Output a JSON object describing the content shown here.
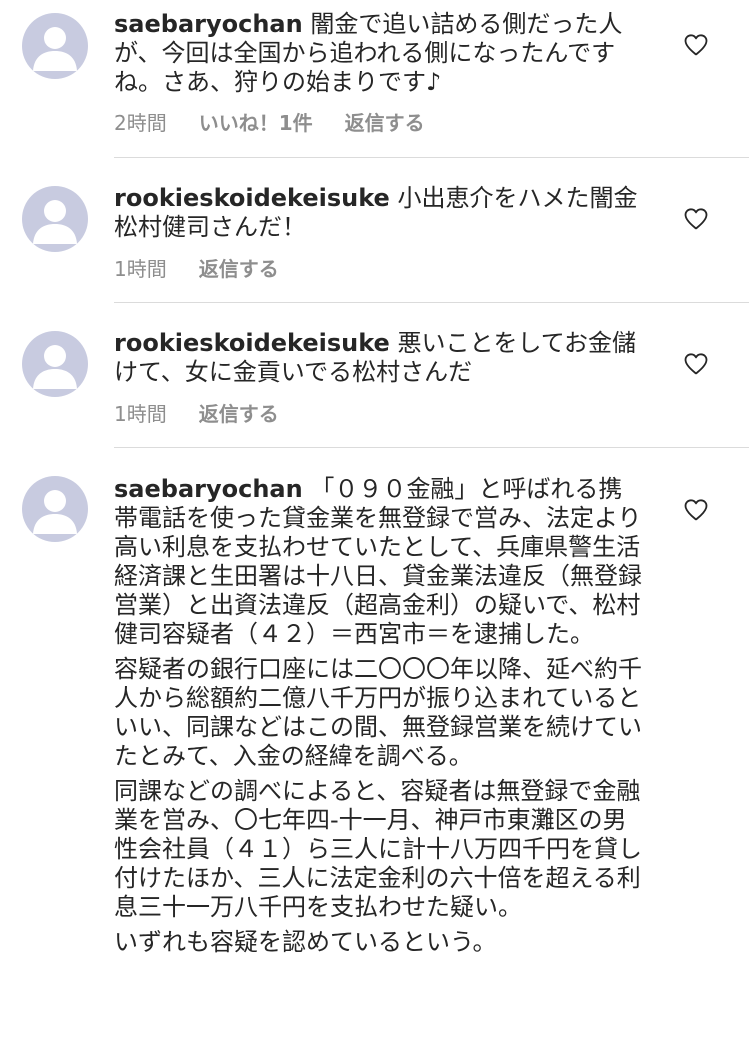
{
  "comments": [
    {
      "username": "saebaryochan",
      "paragraphs": [
        "闇金で追い詰める側だった人が、今回は全国から追われる側になったんですね。さあ、狩りの始まりです♪"
      ],
      "time": "2時間",
      "likes": "いいね！1件",
      "reply": "返信する"
    },
    {
      "username": "rookieskoidekeisuke",
      "paragraphs": [
        "小出恵介をハメた闇金松村健司さんだ！"
      ],
      "time": "1時間",
      "reply": "返信する"
    },
    {
      "username": "rookieskoidekeisuke",
      "paragraphs": [
        "悪いことをしてお金儲けて、女に金貢いでる松村さんだ"
      ],
      "time": "1時間",
      "reply": "返信する"
    },
    {
      "username": "saebaryochan",
      "paragraphs": [
        "「０９０金融」と呼ばれる携帯電話を使った貸金業を無登録で営み、法定より高い利息を支払わせていたとして、兵庫県警生活経済課と生田署は十八日、貸金業法違反（無登録営業）と出資法違反（超高金利）の疑いで、松村健司容疑者（４２）＝西宮市＝を逮捕した。",
        "容疑者の銀行口座には二〇〇〇年以降、延べ約千人から総額約二億八千万円が振り込まれているといい、同課などはこの間、無登録営業を続けていたとみて、入金の経緯を調べる。",
        "同課などの調べによると、容疑者は無登録で金融業を営み、〇七年四-十一月、神戸市東灘区の男性会社員（４１）ら三人に計十八万四千円を貸し付けたほか、三人に法定金利の六十倍を超える利息三十一万八千円を支払わせた疑い。",
        "いずれも容疑を認めているという。"
      ]
    }
  ],
  "colors": {
    "text": "#262626",
    "meta": "#8e8e8e",
    "avatar_bg": "#c8cbe0",
    "avatar_fg": "#ffffff",
    "divider": "#dbdbdb"
  },
  "icons": {
    "avatar": "default-avatar-icon",
    "like": "heart-outline-icon"
  }
}
